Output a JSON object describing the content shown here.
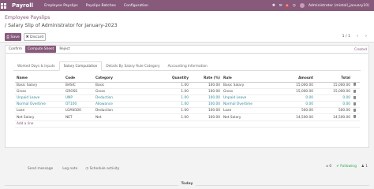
{
  "app": {
    "title": "Payroll",
    "menu": [
      "Employee Payslips",
      "Payslips Batches",
      "Configuration"
    ],
    "user": "Administrator (mistoll_january10)",
    "badge_count": "6"
  },
  "breadcrumb": {
    "parent": "Employee Payslips",
    "current": "Salary Slip of Administrator for January-2023"
  },
  "buttons": {
    "save": "Save",
    "discard": "Discard"
  },
  "pager": {
    "value": "1 / 1"
  },
  "status": {
    "actions": [
      "Confirm",
      "Compute Sheet",
      "Reject"
    ],
    "state": "Created"
  },
  "tabs": [
    "Worked Days & Inputs",
    "Salary Computation",
    "Details By Salary Rule Category",
    "Accounting Information"
  ],
  "table": {
    "headers": [
      "Name",
      "Code",
      "Category",
      "Quantity",
      "Rate (%)",
      "Rule",
      "Amount",
      "Total"
    ],
    "rows": [
      {
        "name": "Basic Salary",
        "code": "BASIC",
        "category": "Basic",
        "quantity": "1.00",
        "rate": "100.00",
        "rule": "Basic Salary",
        "amount": "15,000.00",
        "total": "15,000.00",
        "link": false
      },
      {
        "name": "Gross",
        "code": "GROSS",
        "category": "Gross",
        "quantity": "1.00",
        "rate": "100.00",
        "rule": "Gross",
        "amount": "15,000.00",
        "total": "15,000.00",
        "link": false
      },
      {
        "name": "Unpaid Leave",
        "code": "UNP",
        "category": "Deduction",
        "quantity": "1.00",
        "rate": "100.00",
        "rule": "Unpaid Leave",
        "amount": "0.00",
        "total": "0.00",
        "link": true
      },
      {
        "name": "Normal Overtime",
        "code": "OT100",
        "category": "Allowance",
        "quantity": "1.00",
        "rate": "100.00",
        "rule": "Normal Overtime",
        "amount": "0.00",
        "total": "0.00",
        "link": true
      },
      {
        "name": "Loan",
        "code": "LOAN100",
        "category": "Deduction",
        "quantity": "1.00",
        "rate": "100.00",
        "rule": "Loan",
        "amount": "500.00",
        "total": "500.00",
        "link": false
      },
      {
        "name": "Net Salary",
        "code": "NET",
        "category": "Net",
        "quantity": "1.00",
        "rate": "100.00",
        "rule": "Net Salary",
        "amount": "14,500.00",
        "total": "14,500.00",
        "link": false
      }
    ],
    "add_line": "Add a line"
  },
  "chatter": {
    "send": "Send message",
    "log": "Log note",
    "schedule": "Schedule activity",
    "attachments": "0",
    "followers": "1",
    "following": "Following"
  },
  "divider": {
    "today": "Today"
  },
  "colors": {
    "brand": "#875a7b",
    "link": "#2f8a9a"
  }
}
